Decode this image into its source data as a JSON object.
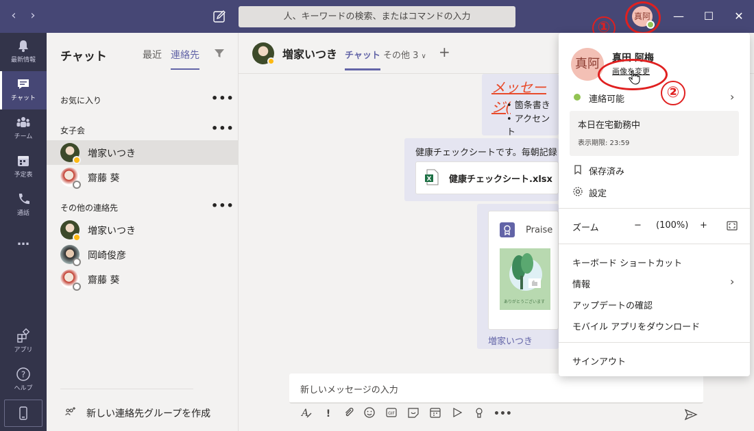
{
  "titlebar": {
    "search_placeholder": "人、キーワードの検索、またはコマンドの入力",
    "avatar_initials": "真阿"
  },
  "annotations": {
    "one": "①",
    "two": "②"
  },
  "rail": {
    "items": [
      {
        "label": "最新情報"
      },
      {
        "label": "チャット"
      },
      {
        "label": "チーム"
      },
      {
        "label": "予定表"
      },
      {
        "label": "通話"
      },
      {
        "label": "アプリ"
      },
      {
        "label": "ヘルプ"
      }
    ],
    "more": "…"
  },
  "chatlist": {
    "title": "チャット",
    "tabs": [
      "最近",
      "連絡先"
    ],
    "groups": [
      {
        "name": "お気に入り",
        "contacts": []
      },
      {
        "name": "女子会",
        "contacts": [
          {
            "name": "増家いつき",
            "status": "away"
          },
          {
            "name": "齋藤 葵",
            "status": "offline"
          }
        ]
      },
      {
        "name": "その他の連絡先",
        "contacts": [
          {
            "name": "増家いつき",
            "status": "away"
          },
          {
            "name": "岡崎俊彦",
            "status": "offline"
          },
          {
            "name": "齋藤 葵",
            "status": "offline"
          }
        ]
      }
    ],
    "more_dots": "•••",
    "new_group": "新しい連絡先グループを作成"
  },
  "conversation": {
    "name": "増家いつき",
    "tabs": {
      "chat": "チャット",
      "more": "その他 3"
    },
    "add": "+",
    "messages": {
      "red_heading": "メッセージ(",
      "bullet1": "• 箇条書き",
      "bullet2": "• アクセント",
      "health_text": "健康チェックシートです。毎朝記録して",
      "file_name": "健康チェックシート.xlsx",
      "praise_label": "Praise",
      "praise_thanks": "ありがとうございます",
      "sender": "増家いつき"
    },
    "compose_placeholder": "新しいメッセージの入力"
  },
  "dropdown": {
    "avatar": "真阿",
    "name": "真田 阿梅",
    "change_image": "画像を変更",
    "status": "連絡可能",
    "status_message": "本日在宅勤務中",
    "expires": "表示期限: 23:59",
    "saved": "保存済み",
    "settings": "設定",
    "zoom_label": "ズーム",
    "zoom_minus": "−",
    "zoom_value": "(100%)",
    "zoom_plus": "+",
    "keyboard": "キーボード ショートカット",
    "info": "情報",
    "update": "アップデートの確認",
    "mobile": "モバイル アプリをダウンロード",
    "signout": "サインアウト"
  },
  "colors": {
    "titlebar": "#464775",
    "rail": "#33344a",
    "accent": "#6264a7",
    "annotation_red": "#e02020",
    "available": "#92c353",
    "away": "#fdb913"
  }
}
